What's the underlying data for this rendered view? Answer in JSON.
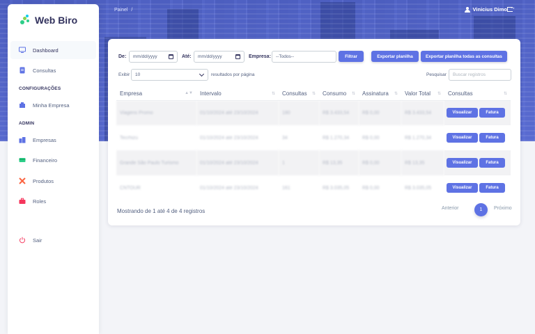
{
  "app": {
    "name": "Web Biro"
  },
  "breadcrumb": {
    "current": "Painel",
    "separator": "/"
  },
  "user": {
    "name": "Vinicius Dimo"
  },
  "sidebar": {
    "items": [
      {
        "label": "Dashboard",
        "icon": "monitor-icon",
        "active": true
      },
      {
        "label": "Consultas",
        "icon": "document-icon"
      }
    ],
    "sections": [
      {
        "heading": "CONFIGURAÇÕES",
        "items": [
          {
            "label": "Minha Empresa",
            "icon": "building-icon"
          }
        ]
      },
      {
        "heading": "ADMIN",
        "items": [
          {
            "label": "Empresas",
            "icon": "buildings-icon"
          },
          {
            "label": "Financeiro",
            "icon": "credit-card-icon"
          },
          {
            "label": "Produtos",
            "icon": "tools-icon"
          },
          {
            "label": "Roles",
            "icon": "briefcase-icon"
          }
        ]
      }
    ],
    "logout": {
      "label": "Sair",
      "icon": "power-icon"
    }
  },
  "filters": {
    "de_label": "De:",
    "de_value": "mm/dd/yyyy",
    "ate_label": "Até:",
    "ate_value": "mm/dd/yyyy",
    "empresa_label": "Empresa:",
    "empresa_value": "--Todos--",
    "filtrar": "Filtrar",
    "exportar": "Exportar planilha",
    "exportar_todas": "Exportar planilha todas as consultas"
  },
  "list_controls": {
    "exibir": "Exibir",
    "page_size": "10",
    "resultados": "resultados por página",
    "pesquisar": "Pesquisar",
    "search_placeholder": "Buscar registros"
  },
  "table": {
    "columns": [
      "Empresa",
      "Intervalo",
      "Consultas",
      "Consumo",
      "Assinatura",
      "Valor Total",
      "Consultas"
    ],
    "rows": [
      {
        "empresa": "Viagens Promo",
        "intervalo": "01/10/2024 até 23/10/2024",
        "consultas": "180",
        "consumo": "R$ 3.433,54",
        "assinatura": "R$ 0,00",
        "valor_total": "R$ 3.433,54"
      },
      {
        "empresa": "Tecrhizu",
        "intervalo": "01/10/2024 até 23/10/2024",
        "consultas": "34",
        "consumo": "R$ 1.270,34",
        "assinatura": "R$ 0,00",
        "valor_total": "R$ 1.270,34"
      },
      {
        "empresa": "Grande São Paulo Turismo",
        "intervalo": "01/10/2024 até 23/10/2024",
        "consultas": "1",
        "consumo": "R$ 13,35",
        "assinatura": "R$ 0,00",
        "valor_total": "R$ 13,35"
      },
      {
        "empresa": "CNTOUR",
        "intervalo": "01/10/2024 até 23/10/2024",
        "consultas": "161",
        "consumo": "R$ 3.035,05",
        "assinatura": "R$ 0,00",
        "valor_total": "R$ 3.035,05"
      }
    ],
    "visualizar": "Visualizar",
    "fatura": "Fatura"
  },
  "footer": {
    "info": "Mostrando de 1 até 4 de 4 registros",
    "anterior": "Anterior",
    "page": "1",
    "proximo": "Próximo"
  },
  "colors": {
    "primary": "#5e72e4",
    "text": "#525f7f",
    "heading": "#32325d"
  }
}
